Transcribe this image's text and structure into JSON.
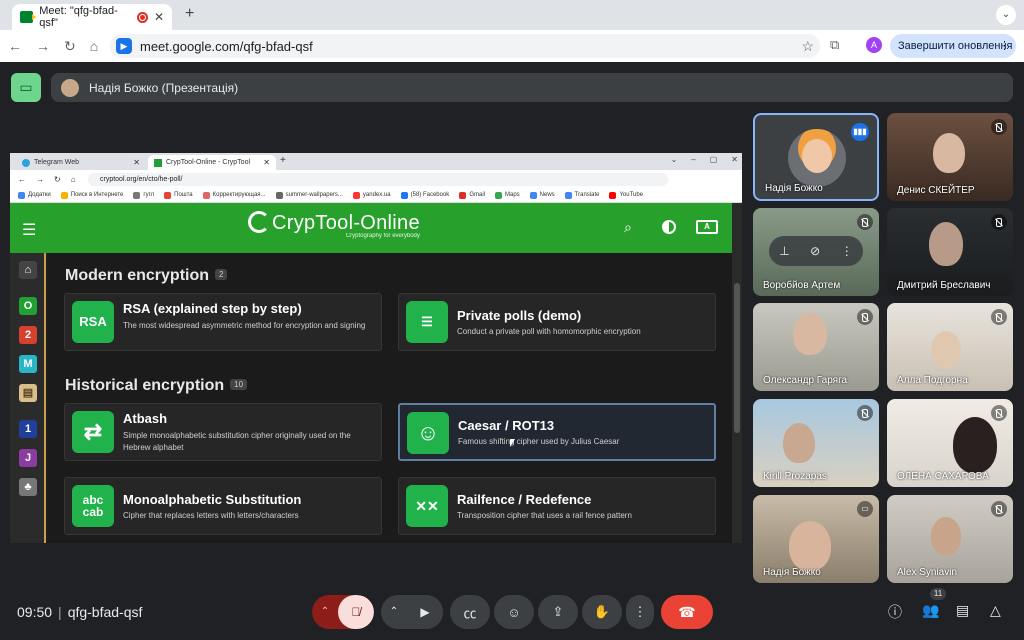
{
  "browser": {
    "tab_title": "Meet: \"qfg-bfad-qsf\"",
    "new_tab": "+",
    "tab_menu": "⌄",
    "url": "meet.google.com/qfg-bfad-qsf",
    "profile": "A",
    "update_label": "Завершити оновлення"
  },
  "meet_header": {
    "presenter": "Надія Божко (Презентація)"
  },
  "shared_screen": {
    "tabs": [
      {
        "label": "Telegram Web"
      },
      {
        "label": "CrypTool-Online - CrypTool"
      }
    ],
    "url": "cryptool.org/en/cto/he-poll/",
    "bookmarks": [
      "Додатки",
      "Поиск в Интернете",
      "гугл",
      "Пошта",
      "Корректирующая...",
      "summer-wallpapers...",
      "yandex.ua",
      "(58) Facebook",
      "Gmail",
      "Maps",
      "News",
      "Translate",
      "YouTube"
    ],
    "site": {
      "logo_title": "CrypTool-Online",
      "logo_sub": "Cryptography for everybody",
      "lang_badge": "A",
      "sidebar": [
        {
          "label": "⌂",
          "color": "#444444"
        },
        {
          "label": "O",
          "color": "#22a036"
        },
        {
          "label": "2",
          "color": "#d6402f"
        },
        {
          "label": "M",
          "color": "#2bb5c9"
        },
        {
          "label": "▤",
          "color": "#d9c08a"
        },
        {
          "label": "1",
          "color": "#1e3f9a"
        },
        {
          "label": "J",
          "color": "#8a3ca0"
        },
        {
          "label": "♣",
          "color": "#777777"
        }
      ],
      "modern": {
        "title": "Modern encryption",
        "count": "2",
        "cards": [
          {
            "icon": "RSA",
            "title": "RSA (explained step by step)",
            "desc": "The most widespread asymmetric method for encryption and signing"
          },
          {
            "icon": "☰",
            "title": "Private polls (demo)",
            "desc": "Conduct a private poll with homomorphic encryption"
          }
        ]
      },
      "historical": {
        "title": "Historical encryption",
        "count": "10",
        "cards": [
          {
            "icon": "⇄",
            "title": "Atbash",
            "desc": "Simple monoalphabetic substitution cipher originally used on the Hebrew alphabet"
          },
          {
            "icon": "☺",
            "title": "Caesar / ROT13",
            "desc": "Famous shifting cipher used by Julius Caesar"
          },
          {
            "icon": "abc cab",
            "title": "Monoalphabetic Substitution",
            "desc": "Cipher that replaces letters with letters/characters"
          },
          {
            "icon": "✕✕",
            "title": "Railfence / Redefence",
            "desc": "Transposition cipher that uses a rail fence pattern"
          }
        ]
      }
    }
  },
  "participants": [
    {
      "name": "Надія Божко"
    },
    {
      "name": "Денис СКЕЙТЕР"
    },
    {
      "name": "Воробйов Артем"
    },
    {
      "name": "Дмитрий Бреславич"
    },
    {
      "name": "Олександр Гаряга"
    },
    {
      "name": "Алла Подгорна"
    },
    {
      "name": "Kirill Prozapas"
    },
    {
      "name": "ОЛЕНА САХАРОВА"
    },
    {
      "name": "Надія Божко"
    },
    {
      "name": "Alex Syniavin"
    }
  ],
  "bottom_bar": {
    "time": "09:50",
    "separator": "|",
    "meeting_code": "qfg-bfad-qsf",
    "participant_count": "11"
  }
}
